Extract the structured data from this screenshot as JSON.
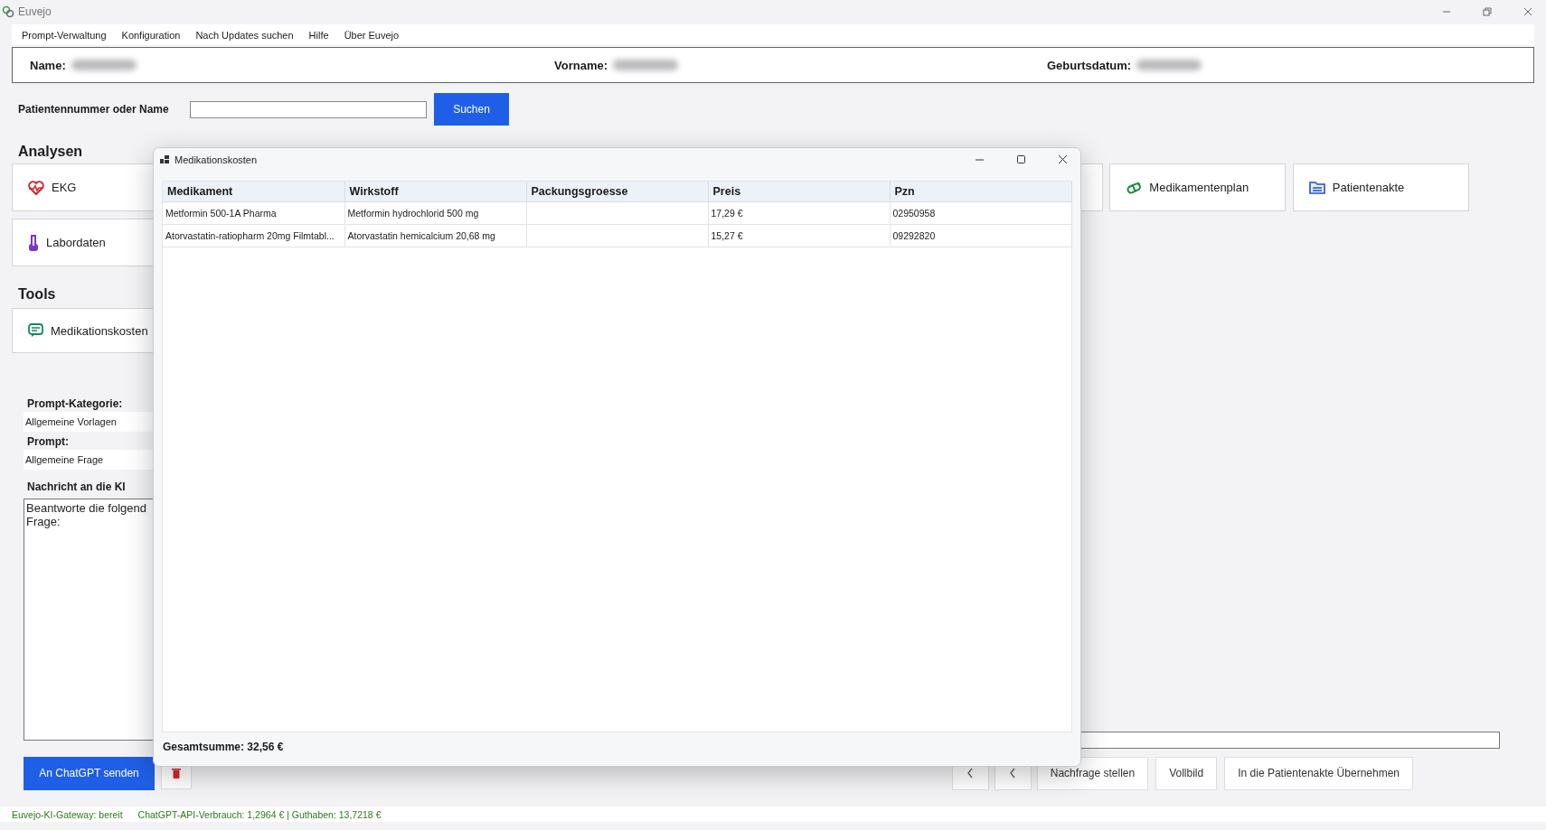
{
  "window": {
    "title": "Euvejo"
  },
  "menu": [
    "Prompt-Verwaltung",
    "Konfiguration",
    "Nach Updates suchen",
    "Hilfe",
    "Über Euvejo"
  ],
  "patient": [
    {
      "label": "Name:"
    },
    {
      "label": "Vorname:"
    },
    {
      "label": "Geburtsdatum:"
    }
  ],
  "search": {
    "label": "Patientennummer oder Name",
    "button": "Suchen"
  },
  "analysen": {
    "title": "Analysen",
    "tiles": [
      {
        "label": "EKG"
      },
      {
        "label": "Labordaten"
      }
    ],
    "tiles_right": [
      {
        "label": "Medikamentenplan"
      },
      {
        "label": "Patientenakte"
      }
    ]
  },
  "tools": {
    "title": "Tools",
    "tiles": [
      {
        "label": "Medikationskosten"
      }
    ]
  },
  "prompt": {
    "category_label": "Prompt-Kategorie:",
    "category": "Allgemeine Vorlagen",
    "prompt_label": "Prompt:",
    "prompt": "Allgemeine Frage",
    "message_label": "Nachricht an die KI",
    "message": "Beantworte die folgend\nFrage:"
  },
  "actions": {
    "send": "An ChatGPT senden",
    "buttons": [
      "Nachfrage stellen",
      "Vollbild",
      "In die Patientenakte Übernehmen"
    ]
  },
  "status_bar": [
    "Euvejo-KI-Gateway: bereit",
    "ChatGPT-API-Verbrauch: 1,2964 € | Guthaben: 13,7218 €"
  ],
  "dialog": {
    "title": "Medikationskosten",
    "table": {
      "columns": [
        "Medikament",
        "Wirkstoff",
        "Packungsgroesse",
        "Preis",
        "Pzn"
      ],
      "rows": [
        [
          "Metformin 500-1A Pharma",
          "Metformin hydrochlorid 500 mg",
          null,
          "17,29 €",
          "02950958"
        ],
        [
          "Atorvastatin-ratiopharm 20mg Filmtabl...",
          "Atorvastatin hemicalcium 20,68 mg",
          null,
          "15,27 €",
          "09292820"
        ]
      ]
    },
    "total": "Gesamtsumme: 32,56 €"
  }
}
